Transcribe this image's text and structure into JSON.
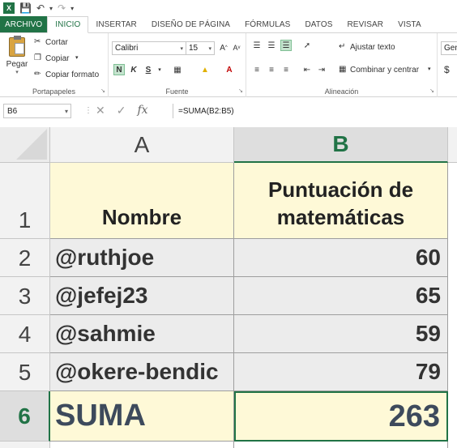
{
  "qat": {
    "app_icon": "X",
    "save_icon": "save-icon",
    "undo_icon": "undo-icon",
    "redo_icon": "redo-icon"
  },
  "tabs": [
    "ARCHIVO",
    "INICIO",
    "INSERTAR",
    "DISEÑO DE PÁGINA",
    "FÓRMULAS",
    "DATOS",
    "REVISAR",
    "VISTA"
  ],
  "active_tab": "INICIO",
  "ribbon": {
    "clipboard": {
      "paste": "Pegar",
      "cut": "Cortar",
      "copy": "Copiar",
      "format_painter": "Copiar formato",
      "label": "Portapapeles"
    },
    "font": {
      "family": "Calibri",
      "size": "15",
      "bold": "N",
      "italic": "K",
      "underline": "S",
      "label": "Fuente"
    },
    "alignment": {
      "wrap": "Ajustar texto",
      "merge": "Combinar y centrar",
      "label": "Alineación"
    },
    "number": {
      "format": "Gen",
      "currency": "$"
    }
  },
  "formula_bar": {
    "name_box": "B6",
    "formula": "=SUMA(B2:B5)",
    "fx": "fx"
  },
  "sheet": {
    "columns": [
      "A",
      "B"
    ],
    "rows": [
      "1",
      "2",
      "3",
      "4",
      "5",
      "6"
    ],
    "header": {
      "a": "Nombre",
      "b": "Puntuación de matemáticas"
    },
    "data": [
      {
        "name": "@ruthjoe",
        "score": "60"
      },
      {
        "name": "@jefej23",
        "score": "65"
      },
      {
        "name": "@sahmie",
        "score": "59"
      },
      {
        "name": "@okere-bendic",
        "score": "79"
      }
    ],
    "total": {
      "label": "SUMA",
      "value": "263"
    }
  },
  "colors": {
    "excel_green": "#217346",
    "header_fill": "#fef9d7",
    "data_fill": "#ececec"
  }
}
